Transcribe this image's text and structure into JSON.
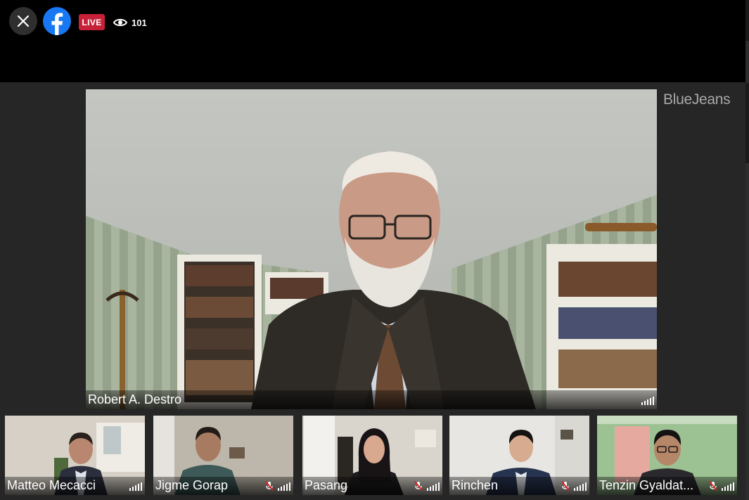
{
  "header": {
    "live_label": "LIVE",
    "viewer_count": "101",
    "icons": [
      "close-icon",
      "facebook-logo-icon",
      "eye-icon"
    ]
  },
  "brand": {
    "name": "BlueJeans"
  },
  "main_speaker": {
    "name": "Robert A. Destro",
    "signal": "signal-bars-icon"
  },
  "participants": [
    {
      "name": "Matteo Mecacci",
      "muted": false
    },
    {
      "name": "Jigme Gorap",
      "muted": true
    },
    {
      "name": "Pasang",
      "muted": true
    },
    {
      "name": "Rinchen",
      "muted": true
    },
    {
      "name": "Tenzin Gyaldat...",
      "muted": true
    }
  ],
  "colors": {
    "facebook_blue": "#1877f2",
    "live_red": "#c7213a",
    "mute_red": "#e02020",
    "background": "#262626",
    "header_bg": "#000000"
  }
}
